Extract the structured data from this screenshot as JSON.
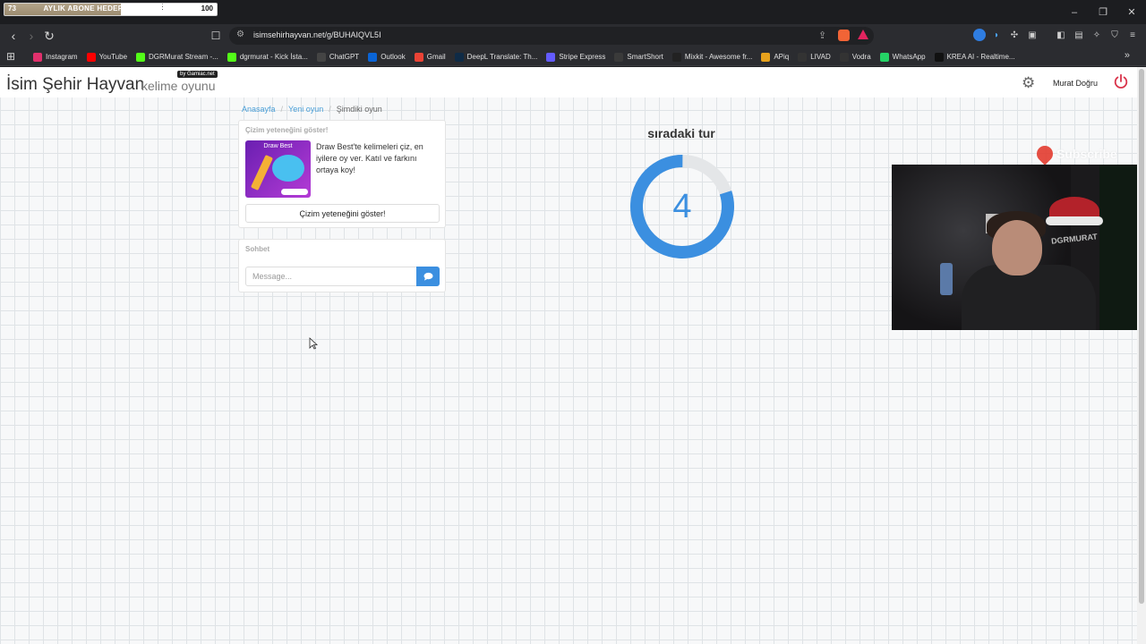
{
  "stream_overlay": {
    "sub_goal_current": "73",
    "sub_goal_label": "AYLIK ABONE HEDEFİ",
    "sub_goal_max": "100",
    "sub_goal_progress": 0.73
  },
  "browser": {
    "url": "isimsehirhayvan.net/g/BUHAIQVL5I",
    "bookmarks": [
      {
        "label": "Instagram",
        "color": "#e1306c",
        "icon": "instagram-icon"
      },
      {
        "label": "YouTube",
        "color": "#ff0000",
        "icon": "youtube-icon"
      },
      {
        "label": "DGRMurat Stream -...",
        "color": "#53fc18",
        "icon": "kick-icon"
      },
      {
        "label": "dgrmurat - Kick İsta...",
        "color": "#53fc18",
        "icon": "kick-icon"
      },
      {
        "label": "ChatGPT",
        "color": "#444444",
        "icon": "chatgpt-icon"
      },
      {
        "label": "Outlook",
        "color": "#0a64d6",
        "icon": "outlook-icon"
      },
      {
        "label": "Gmail",
        "color": "#ea4335",
        "icon": "gmail-icon"
      },
      {
        "label": "DeepL Translate: Th...",
        "color": "#0f2b46",
        "icon": "deepl-icon"
      },
      {
        "label": "Stripe Express",
        "color": "#635bff",
        "icon": "stripe-icon"
      },
      {
        "label": "SmartShort",
        "color": "#3a3a3a",
        "icon": "smartshort-icon"
      },
      {
        "label": "Mixkit - Awesome fr...",
        "color": "#222222",
        "icon": "mixkit-icon"
      },
      {
        "label": "APiq",
        "color": "#e6a11c",
        "icon": "apiq-icon"
      },
      {
        "label": "LIVAD",
        "color": "#333333",
        "icon": "livad-icon"
      },
      {
        "label": "Vodra",
        "color": "#333333",
        "icon": "vodra-icon"
      },
      {
        "label": "WhatsApp",
        "color": "#25d366",
        "icon": "whatsapp-icon"
      },
      {
        "label": "KREA AI - Realtime...",
        "color": "#111111",
        "icon": "krea-icon"
      }
    ]
  },
  "site": {
    "brand_title": "İsim Şehir Hayvan",
    "brand_subtitle": "kelime oyunu",
    "brand_badge": "by Gamiac.net",
    "user_name": "Murat Doğru",
    "accent_color": "#3b8fe0",
    "power_color": "#d9344b"
  },
  "breadcrumb": {
    "items": [
      "Anasayfa",
      "Yeni oyun",
      "Şimdiki oyun"
    ]
  },
  "promo": {
    "title": "Çizim yeteneğini göster!",
    "image_title": "Draw Best",
    "text": "Draw Best'te kelimeleri çiz, en iyilere oy ver. Katıl ve farkını ortaya koy!",
    "button_label": "Çizim yeteneğini göster!"
  },
  "chat": {
    "title": "Sohbet",
    "placeholder": "Message..."
  },
  "round": {
    "title": "sıradaki tur",
    "countdown": "4",
    "countdown_fraction": 0.8
  },
  "webcam": {
    "shirt_text": "DGRMURAT",
    "watermark": "Subscribe"
  }
}
